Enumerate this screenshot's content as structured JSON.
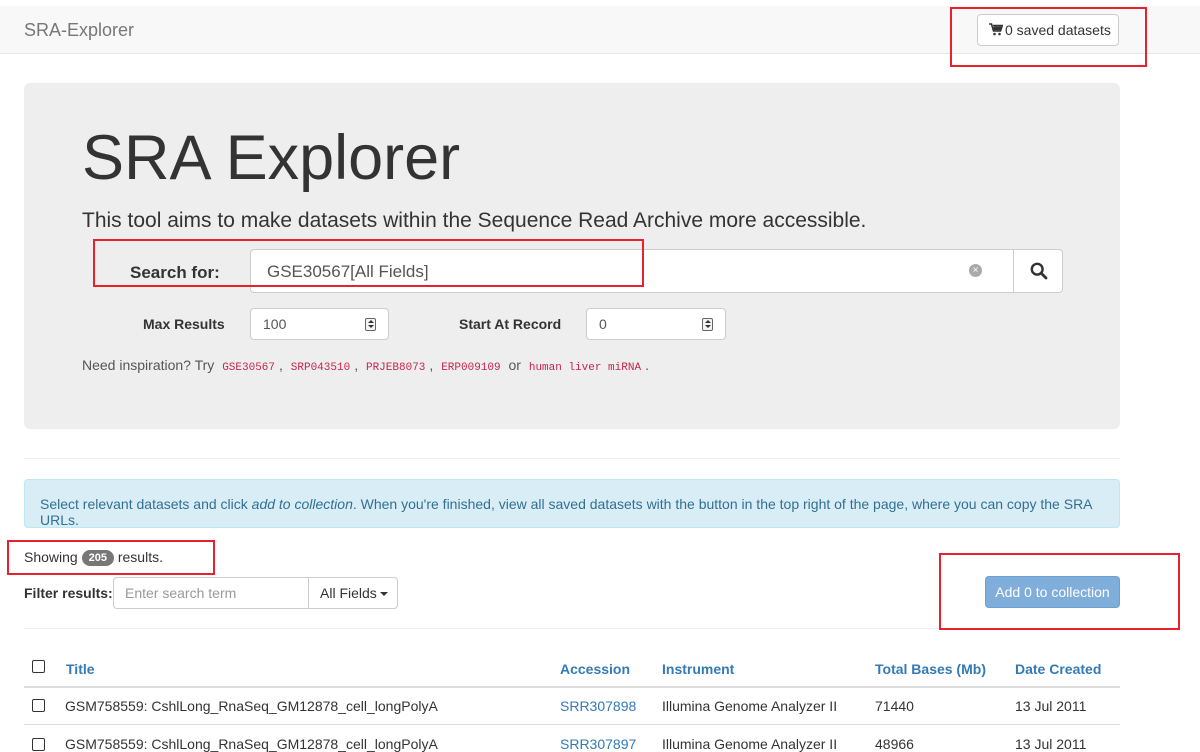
{
  "navbar": {
    "brand": "SRA-Explorer",
    "saved_datasets_label": "0 saved datasets"
  },
  "hero": {
    "title": "SRA Explorer",
    "lead": "This tool aims to make datasets within the Sequence Read Archive more accessible.",
    "search_label": "Search for:",
    "search_value": "GSE30567[All Fields]",
    "max_results_label": "Max Results",
    "max_results_value": "100",
    "start_record_label": "Start At Record",
    "start_record_value": "0",
    "inspiration_prefix": "Need inspiration? Try",
    "examples": [
      "GSE30567",
      "SRP043510",
      "PRJEB8073",
      "ERP009109"
    ],
    "examples_or": "or",
    "example_last": "human liver miRNA"
  },
  "info": {
    "text_a": "Select relevant datasets and click ",
    "text_em": "add to collection",
    "text_b": ". When you're finished, view all saved datasets with the button in the top right of the page, where you can copy the SRA URLs."
  },
  "results": {
    "showing_label": "Showing",
    "count": "205",
    "results_label": "results."
  },
  "filter": {
    "label": "Filter results:",
    "placeholder": "Enter search term",
    "fields_label": "All Fields"
  },
  "add_button_label": "Add 0 to collection",
  "table": {
    "headers": [
      "Title",
      "Accession",
      "Instrument",
      "Total Bases (Mb)",
      "Date Created"
    ],
    "rows": [
      [
        "GSM758559: CshlLong_RnaSeq_GM12878_cell_longPolyA",
        "SRR307898",
        "Illumina Genome Analyzer II",
        "71440",
        "13 Jul 2011"
      ],
      [
        "GSM758559: CshlLong_RnaSeq_GM12878_cell_longPolyA",
        "SRR307897",
        "Illumina Genome Analyzer II",
        "48966",
        "13 Jul 2011"
      ]
    ]
  },
  "colors": {
    "annotation": "#e8212e",
    "link": "#337ab7",
    "info_bg": "#d9edf7",
    "primary_disabled": "#7faedb"
  }
}
